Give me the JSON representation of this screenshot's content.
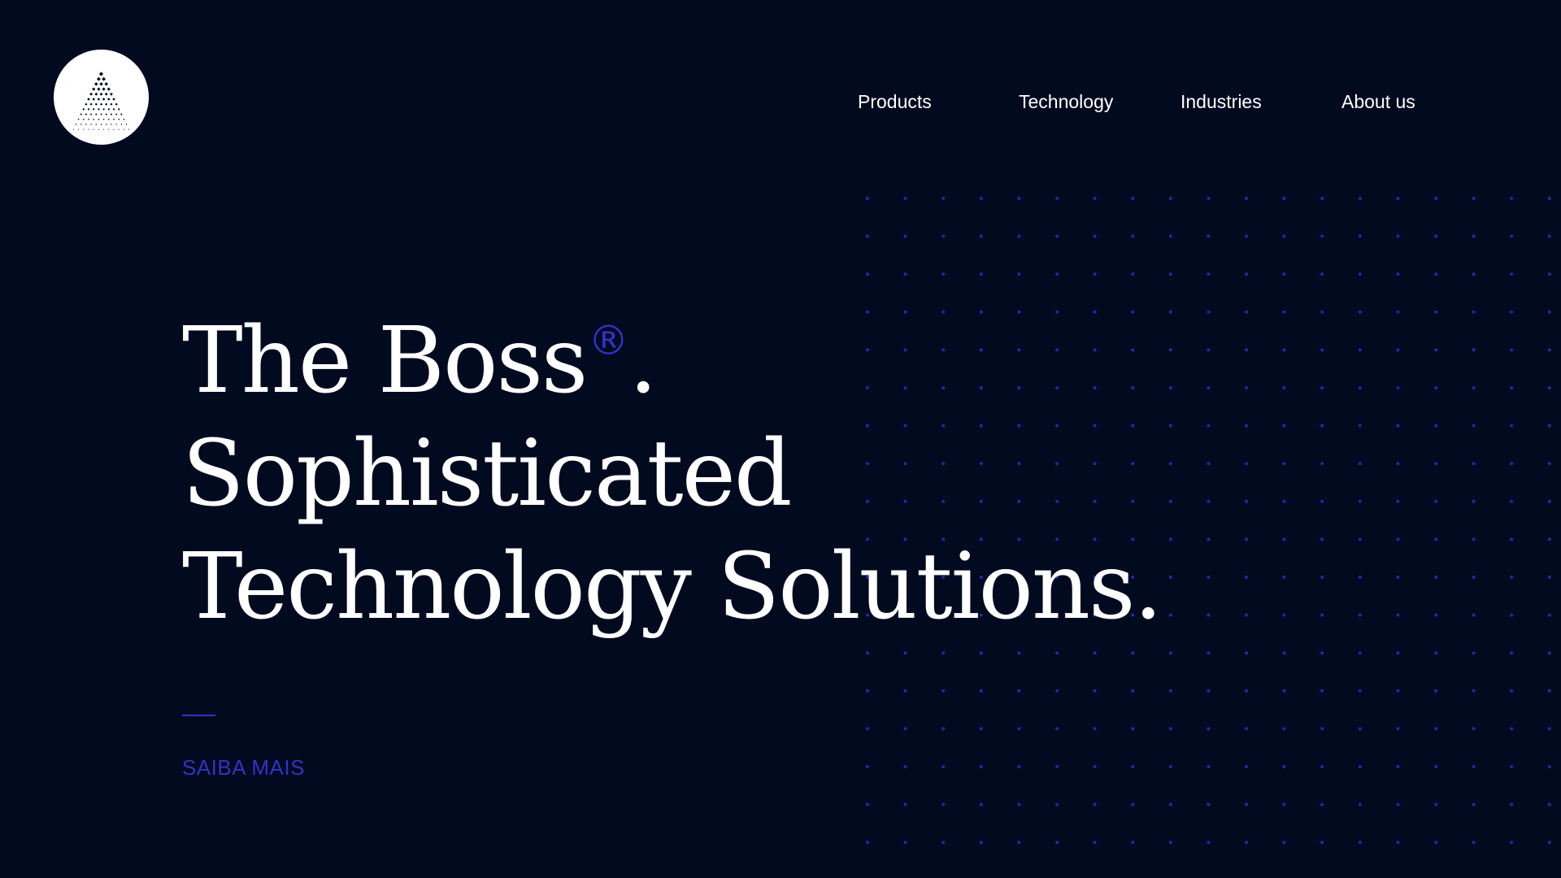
{
  "logo": {
    "icon": "dotted-pyramid-icon",
    "background": "#ffffff",
    "dot_color": "#010a1f"
  },
  "nav": {
    "items": [
      {
        "label": "Products"
      },
      {
        "label": "Technology"
      },
      {
        "label": "Industries"
      },
      {
        "label": "About us"
      }
    ]
  },
  "hero": {
    "line1_text": "The Boss",
    "line1_mark": "®",
    "line1_end": ".",
    "line2": "Sophisticated",
    "line3": "Technology Solutions."
  },
  "cta": {
    "label": "SAIBA MAIS"
  },
  "colors": {
    "background": "#010a1f",
    "accent": "#2e34c8",
    "text": "#ffffff",
    "grid_dot": "#1f2aa8"
  }
}
